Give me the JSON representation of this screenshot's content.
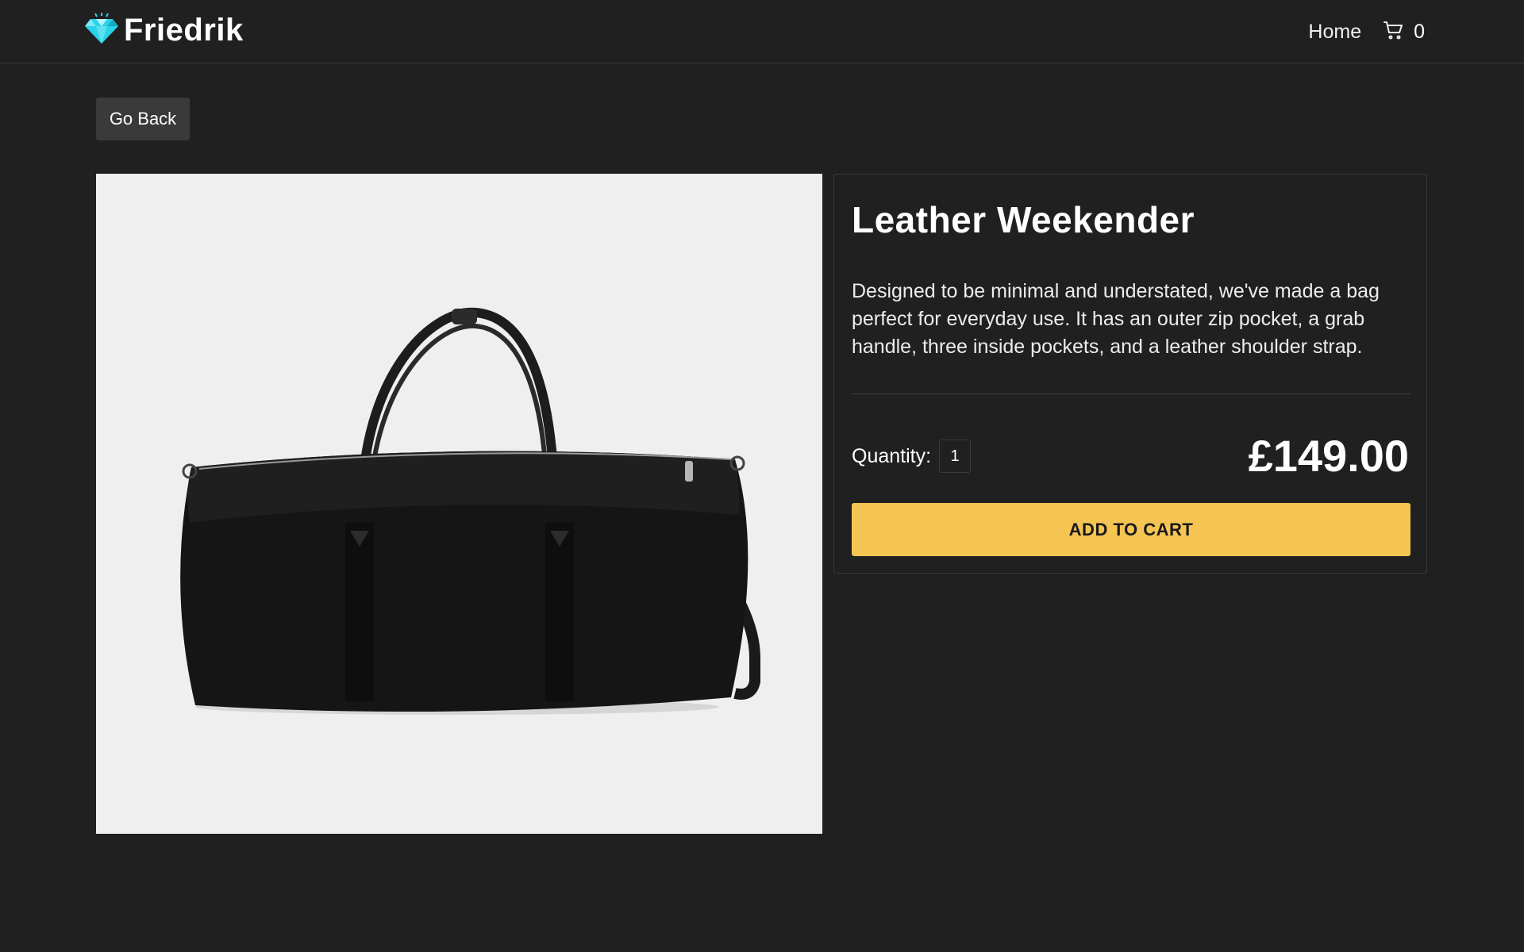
{
  "navbar": {
    "brand": "Friedrik",
    "brand_icon": "diamond-icon",
    "home_label": "Home",
    "cart_icon": "cart-icon",
    "cart_count": "0"
  },
  "actions": {
    "go_back_label": "Go Back"
  },
  "product": {
    "image_alt": "Leather Weekender",
    "title": "Leather Weekender",
    "description": "Designed to be minimal and understated, we've made a bag perfect for everyday use. It has an outer zip pocket, a grab handle, three inside pockets, and a leather shoulder strap.",
    "quantity_label": "Quantity:",
    "quantity_value": "1",
    "price": "£149.00",
    "add_to_cart_label": "ADD TO CART"
  },
  "colors": {
    "background": "#202020",
    "accent_button": "#f4c553",
    "brand_icon": "#29d3e8"
  }
}
